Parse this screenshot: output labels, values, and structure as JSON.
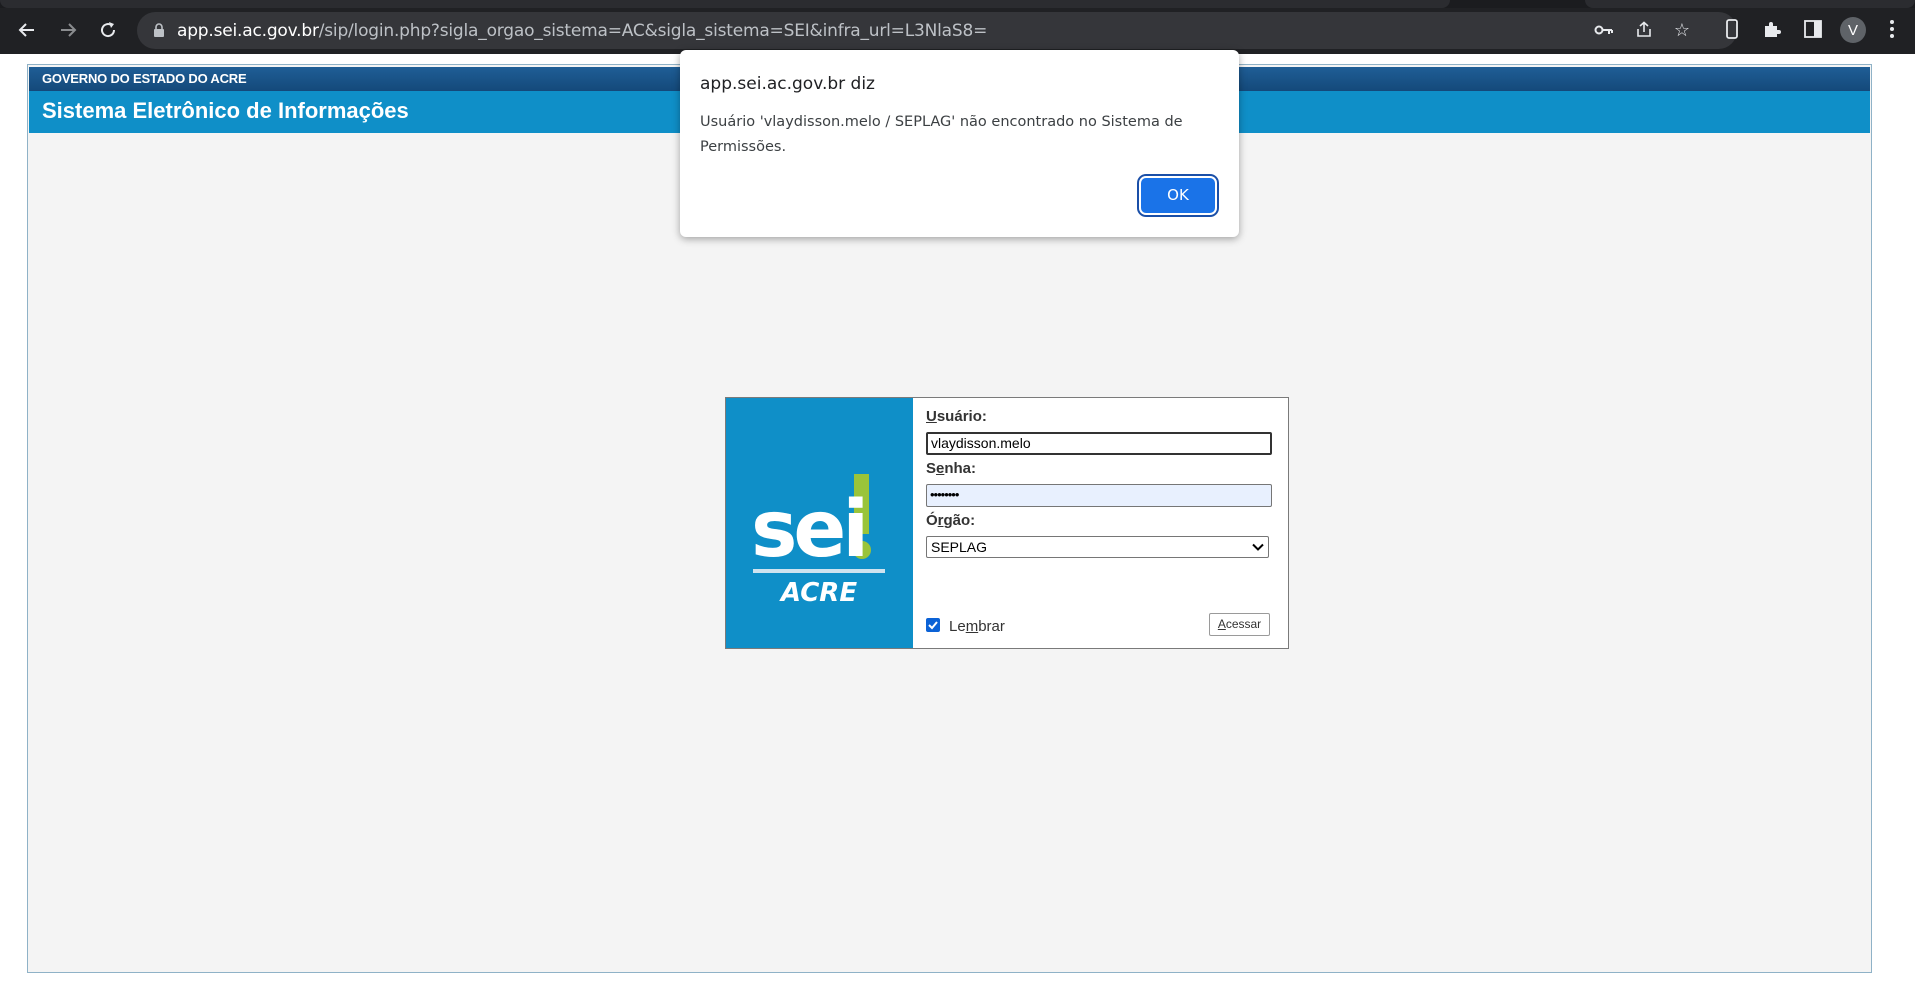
{
  "browser": {
    "url_host": "app.sei.ac.gov.br",
    "url_path": "/sip/login.php?sigla_orgao_sistema=AC&sigla_sistema=SEI&infra_url=L3NlaS8=",
    "profile_initial": "V",
    "icons": [
      "back-icon",
      "forward-icon",
      "reload-icon",
      "lock-icon",
      "key-icon",
      "share-icon",
      "star-icon",
      "phone-icon",
      "extensions-icon",
      "sidepanel-icon",
      "menu-icon"
    ]
  },
  "header": {
    "government": "GOVERNO DO ESTADO DO ACRE",
    "system_title": "Sistema Eletrônico de Informações",
    "colors": {
      "top_bar": "#14497a",
      "title_bar": "#0f8fc8"
    }
  },
  "logo": {
    "word": "sei",
    "state": "ACRE",
    "accent_color": "#9ac43a"
  },
  "login": {
    "user_label_u": "U",
    "user_label_rest": "suário:",
    "user_value": "vlaydisson.melo",
    "password_label_1": "S",
    "password_label_u": "e",
    "password_label_rest": "nha:",
    "password_value": "••••••••",
    "org_label_1": "Ó",
    "org_label_u": "r",
    "org_label_rest": "gão:",
    "org_selected": "SEPLAG",
    "remember_1": "Le",
    "remember_u": "m",
    "remember_rest": "brar",
    "remember_checked": true,
    "access_u": "A",
    "access_rest": "cessar"
  },
  "dialog": {
    "title": "app.sei.ac.gov.br diz",
    "message": "Usuário 'vlaydisson.melo / SEPLAG' não encontrado no Sistema de Permissões.",
    "ok_label": "OK"
  }
}
